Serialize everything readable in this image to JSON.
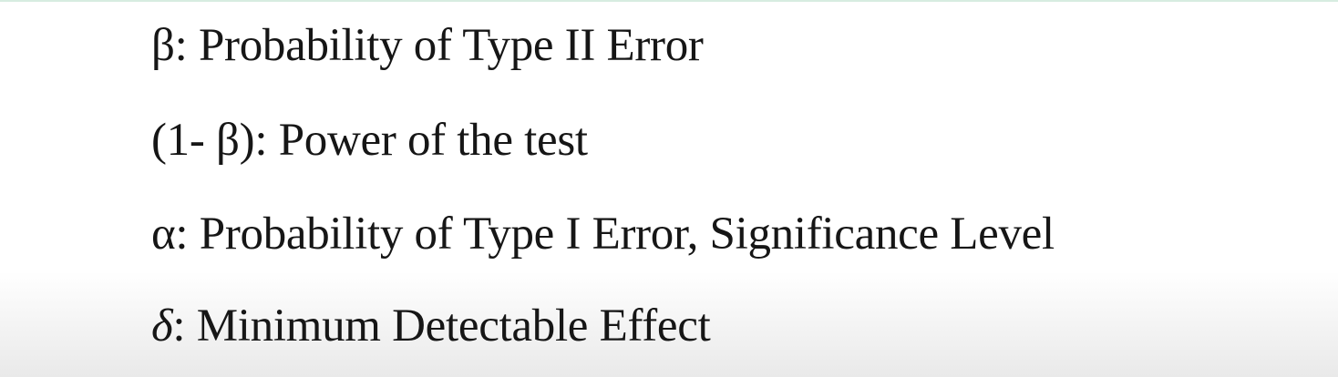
{
  "definitions": [
    {
      "symbol": "β",
      "description": "Probability of Type II Error"
    },
    {
      "symbol": "(1- β)",
      "description": "Power of the test"
    },
    {
      "symbol": "α",
      "description": "Probability of Type I Error, Significance Level"
    },
    {
      "symbol": "δ",
      "description": "Minimum Detectable Effect"
    }
  ],
  "separator": ": ",
  "colors": {
    "text": "#161616",
    "background": "#ffffff",
    "top_accent": "#d7ece1"
  }
}
